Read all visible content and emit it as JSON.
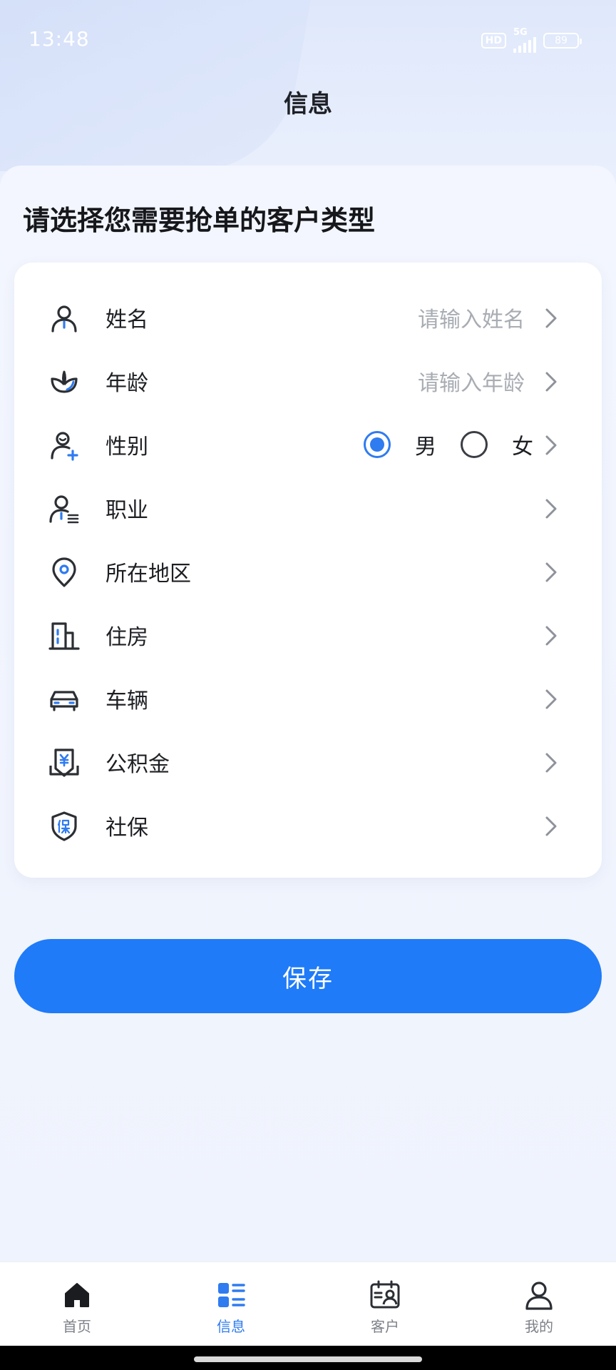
{
  "status_bar": {
    "time": "13:48",
    "hd": "HD",
    "network": "5G",
    "battery": "89"
  },
  "nav": {
    "title": "信息"
  },
  "heading": "请选择您需要抢单的客户类型",
  "form": {
    "rows": [
      {
        "label": "姓名",
        "placeholder": "请输入姓名",
        "icon": "person-icon"
      },
      {
        "label": "年龄",
        "placeholder": "请输入年龄",
        "icon": "leaf-icon"
      },
      {
        "label": "性别",
        "icon": "person-plus-icon"
      },
      {
        "label": "职业",
        "icon": "person-id-icon"
      },
      {
        "label": "所在地区",
        "icon": "location-pin-icon"
      },
      {
        "label": "住房",
        "icon": "building-icon"
      },
      {
        "label": "车辆",
        "icon": "car-icon"
      },
      {
        "label": "公积金",
        "icon": "fund-card-icon"
      },
      {
        "label": "社保",
        "icon": "shield-icon"
      }
    ],
    "gender": {
      "male": "男",
      "female": "女",
      "selected": "男"
    }
  },
  "save_button": "保存",
  "tabs": [
    {
      "label": "首页",
      "icon": "home-icon",
      "active": false
    },
    {
      "label": "信息",
      "icon": "list-icon",
      "active": true
    },
    {
      "label": "客户",
      "icon": "customer-card-icon",
      "active": false
    },
    {
      "label": "我的",
      "icon": "user-icon",
      "active": false
    }
  ],
  "colors": {
    "accent": "#1f7bf8",
    "icon_dark": "#2b2e33",
    "icon_accent": "#2f7bf0",
    "text_placeholder": "#a8acb3"
  }
}
